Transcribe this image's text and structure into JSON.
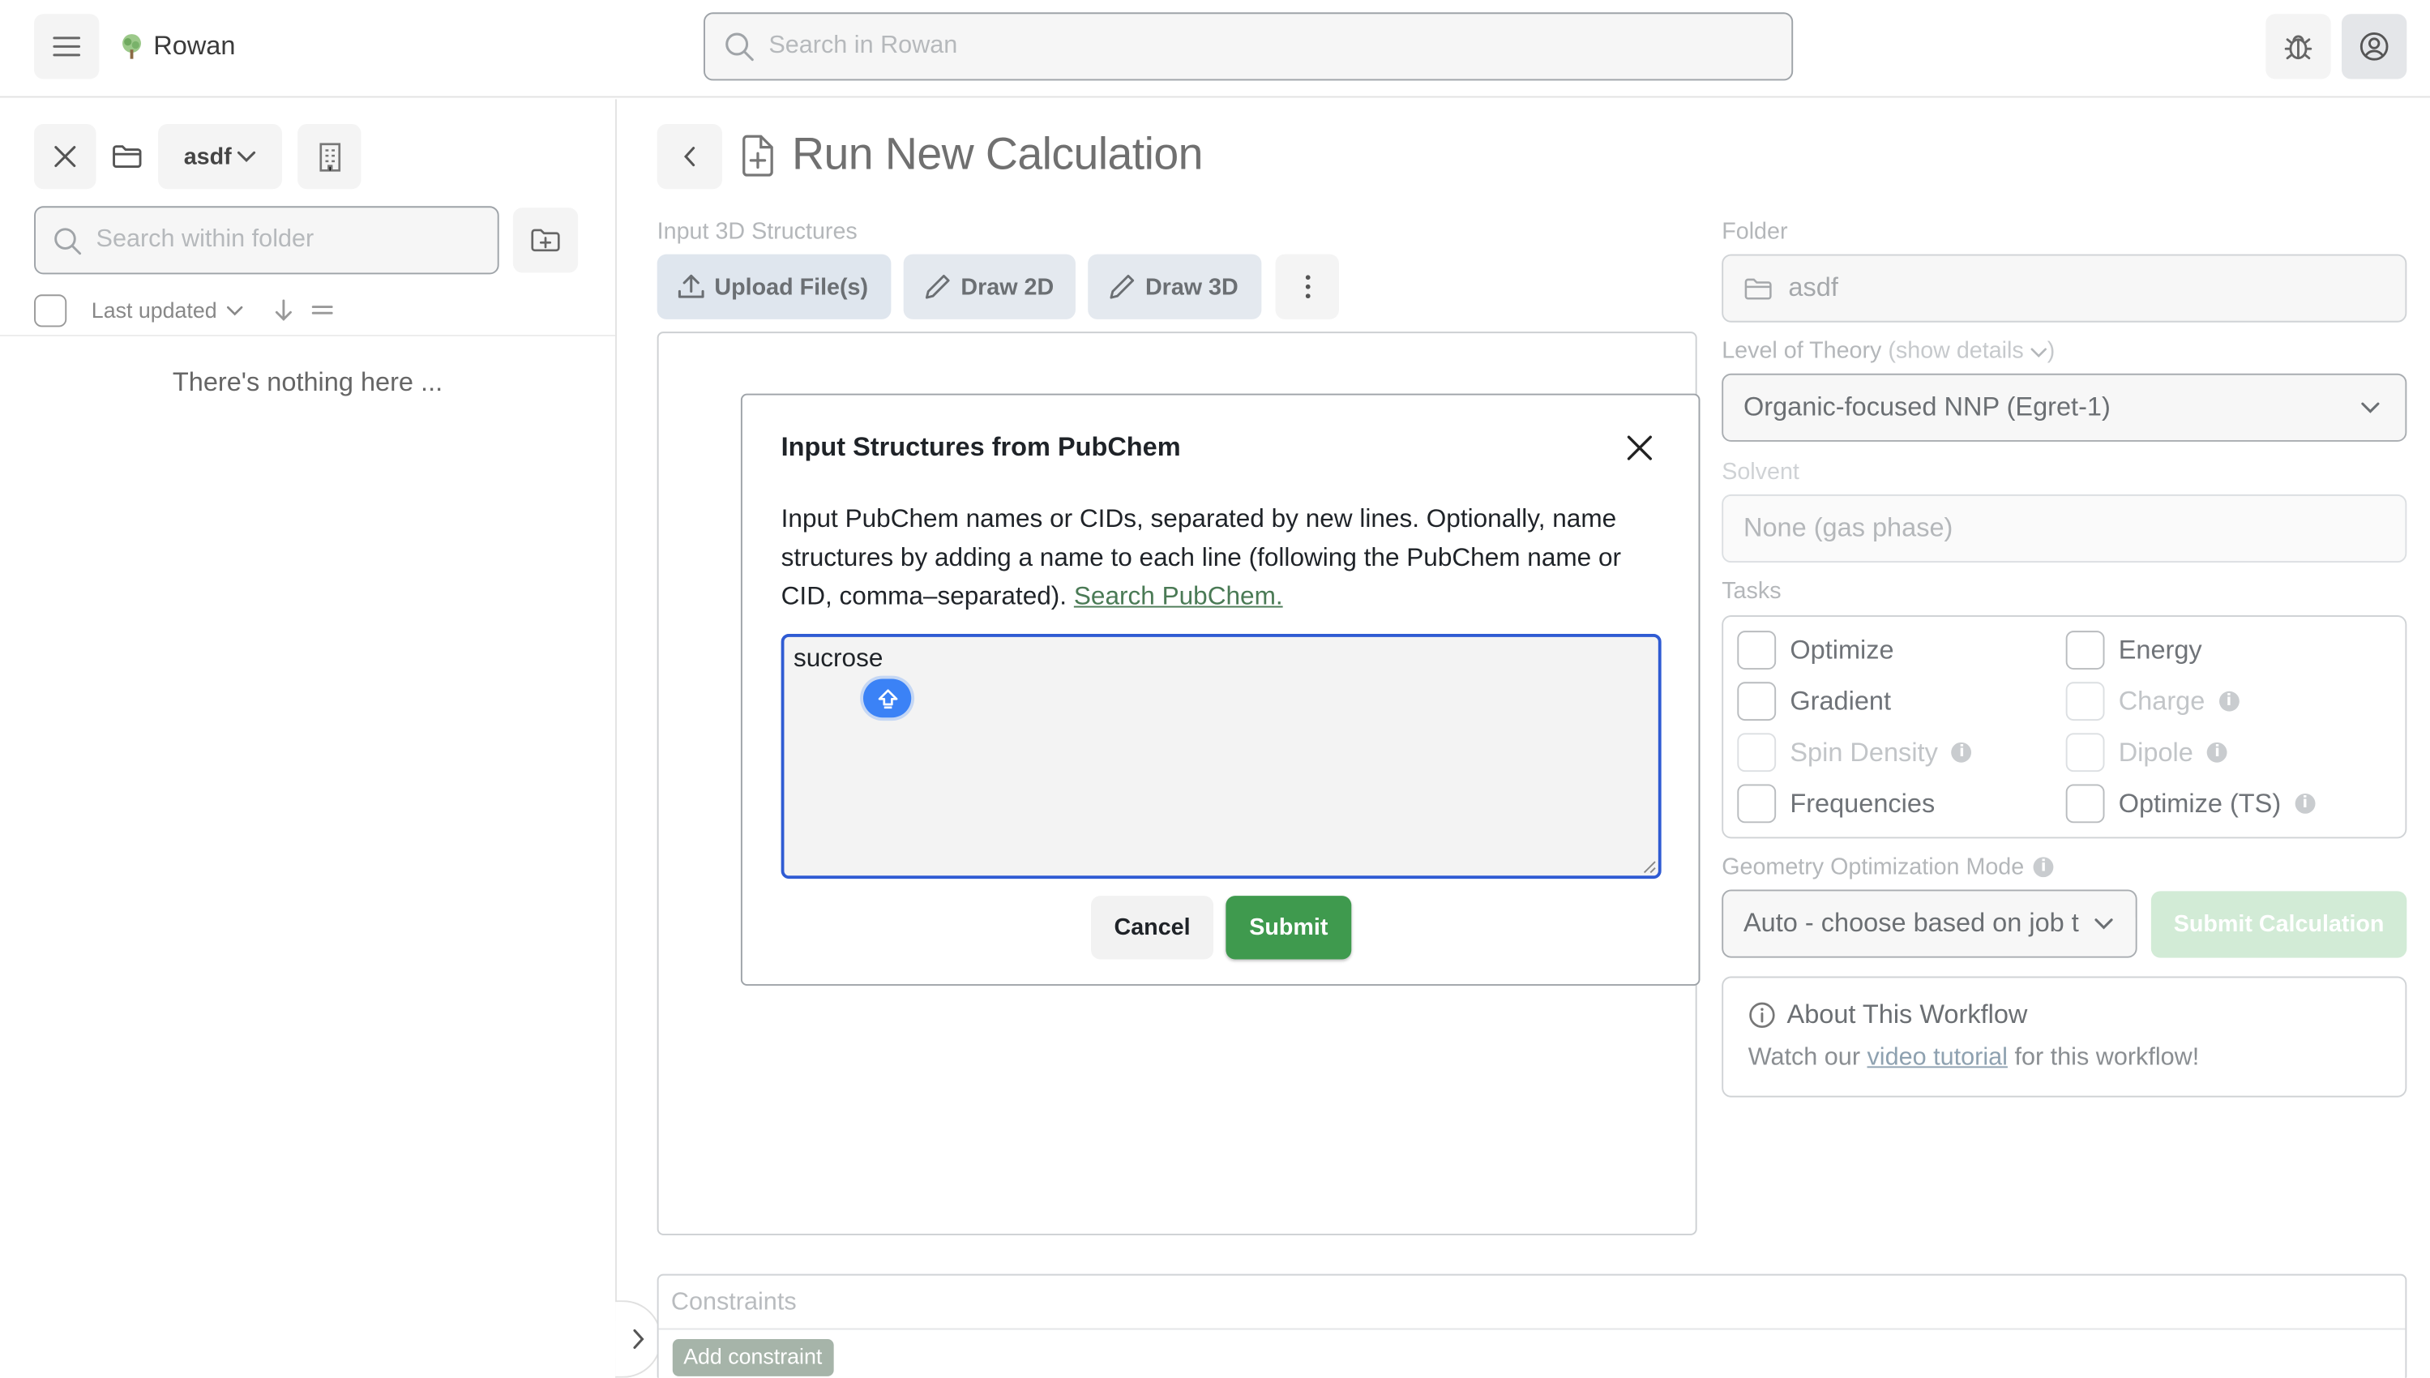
{
  "app": {
    "name": "Rowan",
    "logo_icon": "tree-icon"
  },
  "header": {
    "search_placeholder": "Search in Rowan",
    "icons": [
      "menu-icon",
      "search-icon",
      "bug-icon",
      "user-icon"
    ]
  },
  "sidebar": {
    "folder_name": "asdf",
    "search_placeholder": "Search within folder",
    "sort_label": "Last updated",
    "empty_text": "There's nothing here ...",
    "icons": [
      "close-icon",
      "folder-icon",
      "building-icon",
      "new-folder-icon",
      "arrow-down-icon",
      "equals-icon",
      "chevron-right-icon"
    ]
  },
  "main": {
    "title": "Run New Calculation",
    "input_label": "Input 3D Structures",
    "buttons": {
      "upload": "Upload File(s)",
      "draw2d": "Draw 2D",
      "draw3d": "Draw 3D"
    },
    "constraints_label": "Constraints",
    "add_constraint": "Add constraint"
  },
  "right_panel": {
    "folder_label": "Folder",
    "folder_value": "asdf",
    "level_label": "Level of Theory",
    "level_details": "(show details",
    "level_value": "Organic-focused NNP (Egret-1)",
    "solvent_label": "Solvent",
    "solvent_value": "None (gas phase)",
    "tasks_label": "Tasks",
    "tasks": [
      {
        "label": "Optimize",
        "enabled": true,
        "info": false
      },
      {
        "label": "Energy",
        "enabled": true,
        "info": false
      },
      {
        "label": "Gradient",
        "enabled": true,
        "info": false
      },
      {
        "label": "Charge",
        "enabled": false,
        "info": true
      },
      {
        "label": "Spin Density",
        "enabled": false,
        "info": true
      },
      {
        "label": "Dipole",
        "enabled": false,
        "info": true
      },
      {
        "label": "Frequencies",
        "enabled": true,
        "info": false
      },
      {
        "label": "Optimize (TS)",
        "enabled": true,
        "info": true
      }
    ],
    "geo_label": "Geometry Optimization Mode",
    "geo_value": "Auto - choose based on job t",
    "submit_label": "Submit Calculation",
    "about_title": "About This Workflow",
    "about_prefix": "Watch our ",
    "about_link": "video tutorial",
    "about_suffix": " for this workflow!"
  },
  "modal": {
    "title": "Input Structures from PubChem",
    "body": "Input PubChem names or CIDs, separated by new lines. Optionally, name structures by adding a name to each line (following the PubChem name or CID, comma–separated).",
    "link": "Search PubChem.",
    "textarea_value": "sucrose",
    "cancel_label": "Cancel",
    "submit_label": "Submit"
  },
  "colors": {
    "accent_green": "#3f9a4e",
    "focus_blue": "#2f5bd3",
    "disabled_green": "#d2ebd6"
  }
}
